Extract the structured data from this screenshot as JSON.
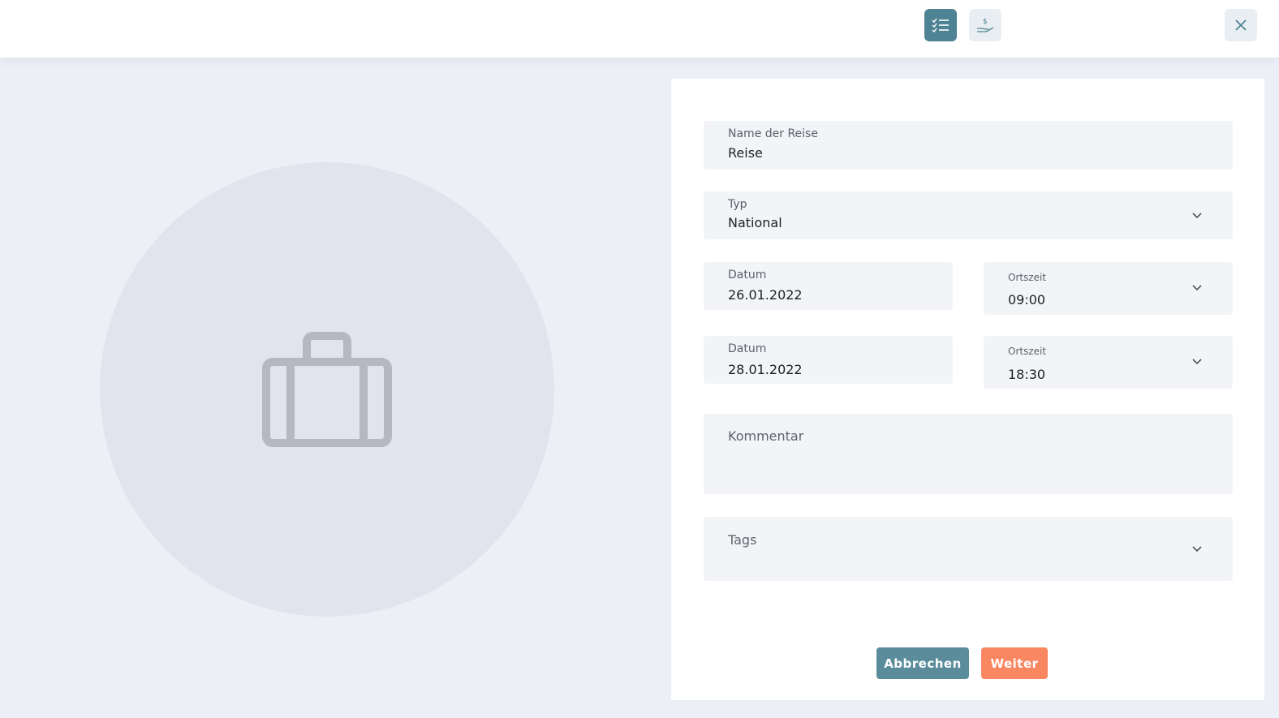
{
  "toolbar": {
    "icons": [
      "checklist-icon",
      "money-hand-icon",
      "close-icon"
    ],
    "active_color": "#4e8394"
  },
  "placeholder": {
    "icon": "suitcase-icon"
  },
  "form": {
    "name": {
      "label": "Name der Reise",
      "value": "Reise"
    },
    "type": {
      "label": "Typ",
      "value": "National"
    },
    "start_date": {
      "label": "Datum",
      "value": "26.01.2022"
    },
    "start_time": {
      "label": "Ortszeit",
      "value": "09:00"
    },
    "end_date": {
      "label": "Datum",
      "value": "28.01.2022"
    },
    "end_time": {
      "label": "Ortszeit",
      "value": "18:30"
    },
    "comment": {
      "label": "Kommentar"
    },
    "tags": {
      "label": "Tags"
    }
  },
  "actions": {
    "cancel_label": "Abbrechen",
    "next_label": "Weiter",
    "cancel_color": "#5a8c9c",
    "next_color": "#f98762"
  }
}
